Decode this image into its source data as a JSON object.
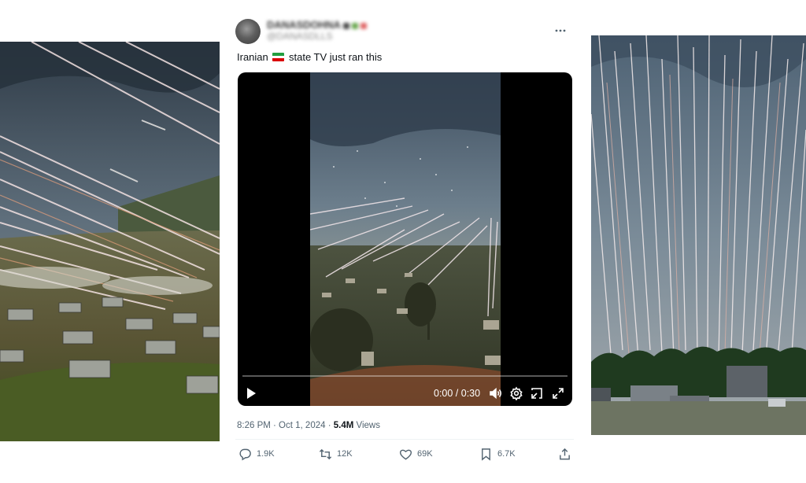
{
  "tweet": {
    "display_name": "DANASDOHNA",
    "handle": "@DANASDLLS",
    "text_before": "Iranian",
    "text_after": "state TV just ran this",
    "flag_icon": "iran-flag-icon",
    "more_icon": "more-horizontal-icon",
    "meta_time": "8:26 PM · Oct 1, 2024 · ",
    "views_count": "5.4M",
    "views_label": " Views"
  },
  "video": {
    "time": "0:00 / 0:30",
    "progress": 0,
    "icons": [
      "play-icon",
      "volume-icon",
      "settings-icon",
      "dock-icon",
      "fullscreen-icon"
    ]
  },
  "actions": {
    "reply_count": "1.9K",
    "retweet_count": "12K",
    "like_count": "69K",
    "bookmark_count": "6.7K",
    "icons": [
      "reply-icon",
      "retweet-icon",
      "like-icon",
      "bookmark-icon",
      "share-icon"
    ]
  },
  "colors": {
    "text_primary": "#0f1419",
    "text_secondary": "#536471",
    "flag_green": "#239f40",
    "flag_white": "#ffffff",
    "flag_red": "#da0000"
  }
}
